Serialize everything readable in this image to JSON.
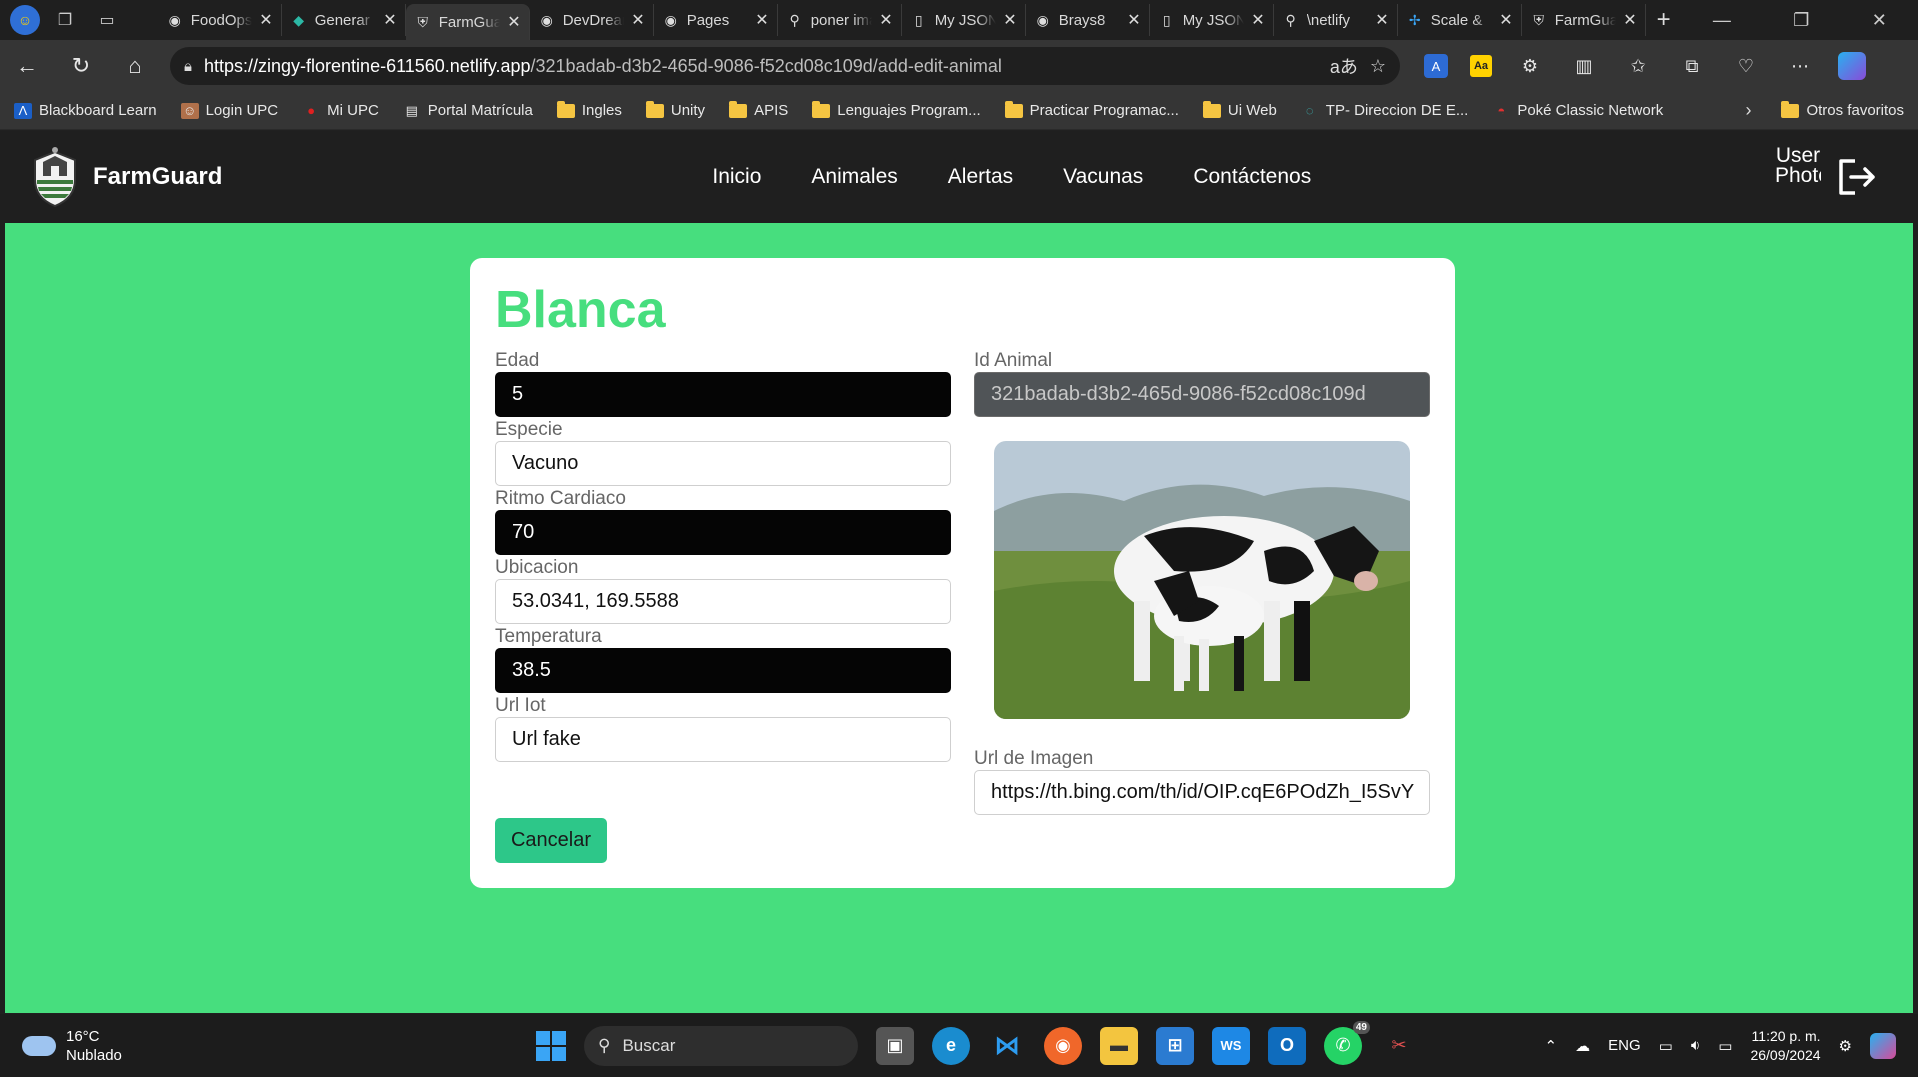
{
  "browser": {
    "tabs": [
      {
        "label": "FoodOps",
        "icon": "github-icon"
      },
      {
        "label": "Generar",
        "icon": "generic-site-icon"
      },
      {
        "label": "FarmGuard",
        "icon": "farmguard-icon",
        "active": true
      },
      {
        "label": "DevDream",
        "icon": "github-icon"
      },
      {
        "label": "Pages",
        "icon": "github-icon"
      },
      {
        "label": "poner imagen",
        "icon": "search-icon"
      },
      {
        "label": "My JSON",
        "icon": "page-icon"
      },
      {
        "label": "Brays8",
        "icon": "github-icon"
      },
      {
        "label": "My JSON",
        "icon": "page-icon"
      },
      {
        "label": "\\netlify",
        "icon": "search-icon"
      },
      {
        "label": "Scale & ",
        "icon": "scale-icon"
      },
      {
        "label": "FarmGuard",
        "icon": "farmguard-icon"
      }
    ],
    "url_host": "https://zingy-florentine-611560.netlify.app",
    "url_path": "/321badab-d3b2-465d-9086-f52cd08c109d/add-edit-animal",
    "bookmarks": [
      {
        "label": "Blackboard Learn",
        "icon": "blackboard-icon"
      },
      {
        "label": "Login UPC",
        "icon": "user-icon"
      },
      {
        "label": "Mi UPC",
        "icon": "upc-icon"
      },
      {
        "label": "Portal Matrícula",
        "icon": "page-icon"
      },
      {
        "label": "Ingles",
        "icon": "folder-icon"
      },
      {
        "label": "Unity",
        "icon": "folder-icon"
      },
      {
        "label": "APIS",
        "icon": "folder-icon"
      },
      {
        "label": "Lenguajes Program...",
        "icon": "folder-icon"
      },
      {
        "label": "Practicar Programac...",
        "icon": "folder-icon"
      },
      {
        "label": "Ui Web",
        "icon": "folder-icon"
      },
      {
        "label": "TP- Direccion DE E...",
        "icon": "site-icon"
      },
      {
        "label": "Poké Classic Network",
        "icon": "pokeball-icon"
      }
    ],
    "other_favorites": "Otros favoritos"
  },
  "app": {
    "brand": "FarmGuard",
    "menu": [
      "Inicio",
      "Animales",
      "Alertas",
      "Vacunas",
      "Contáctenos"
    ],
    "user_photo_alt": "User Photo"
  },
  "form": {
    "title": "Blanca",
    "edad_label": "Edad",
    "edad_value": "5",
    "especie_label": "Especie",
    "especie_value": "Vacuno",
    "ritmo_label": "Ritmo Cardiaco",
    "ritmo_value": "70",
    "ubicacion_label": "Ubicacion",
    "ubicacion_value": "53.0341, 169.5588",
    "temperatura_label": "Temperatura",
    "temperatura_value": "38.5",
    "urliot_label": "Url Iot",
    "urliot_value": "Url fake",
    "id_label": "Id Animal",
    "id_value": "321badab-d3b2-465d-9086-f52cd08c109d",
    "urlimg_label": "Url de Imagen",
    "urlimg_value": "https://th.bing.com/th/id/OIP.cqE6POdZh_I5SvY",
    "cancel_label": "Cancelar"
  },
  "taskbar": {
    "temp": "16°C",
    "weather": "Nublado",
    "search": "Buscar",
    "whatsapp_badge": "49",
    "lang": "ENG",
    "time": "11:20 p. m.",
    "date": "26/09/2024"
  }
}
